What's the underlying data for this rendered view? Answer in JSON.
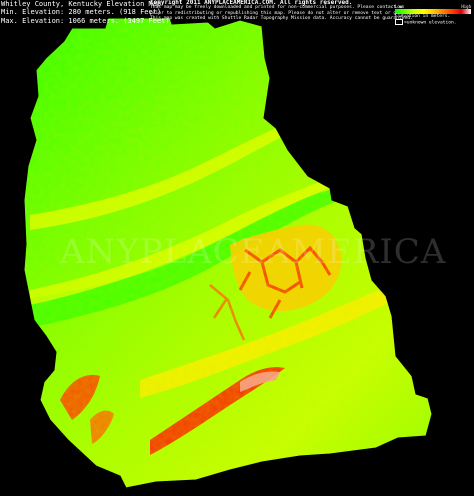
{
  "title": "Whitley County, Kentucky Elevation Map",
  "min_elevation": "Min. Elevation: 280 meters. (918 Feet)",
  "max_elevation": "Max. Elevation: 1066 meters. (3497 Feet)",
  "copyright": "Copyright 2011 ANYPLACEAMERICA.COM. All rights reserved.",
  "notice_lines": [
    "This map may be freely downloaded and printed for non-commercial purposes. Please contact us",
    "prior to redistributing or republishing this map. Please do not alter or remove text or graphics.",
    "This map was created with Shuttle Radar Topography Mission data. Accuracy cannot be guaranteed."
  ],
  "legend": {
    "scale_low": "Low",
    "scale_high": "High",
    "elevation_label": "Elevation in meters.",
    "unknown_label": "=unknown elevation."
  },
  "watermark": "ANYPLACEAMERICA",
  "colors": {
    "background": "#000000",
    "low": "#00ff00",
    "mid": "#ffff00",
    "high": "#ff2200",
    "peak": "#ffffff",
    "unknown": "#000000"
  }
}
